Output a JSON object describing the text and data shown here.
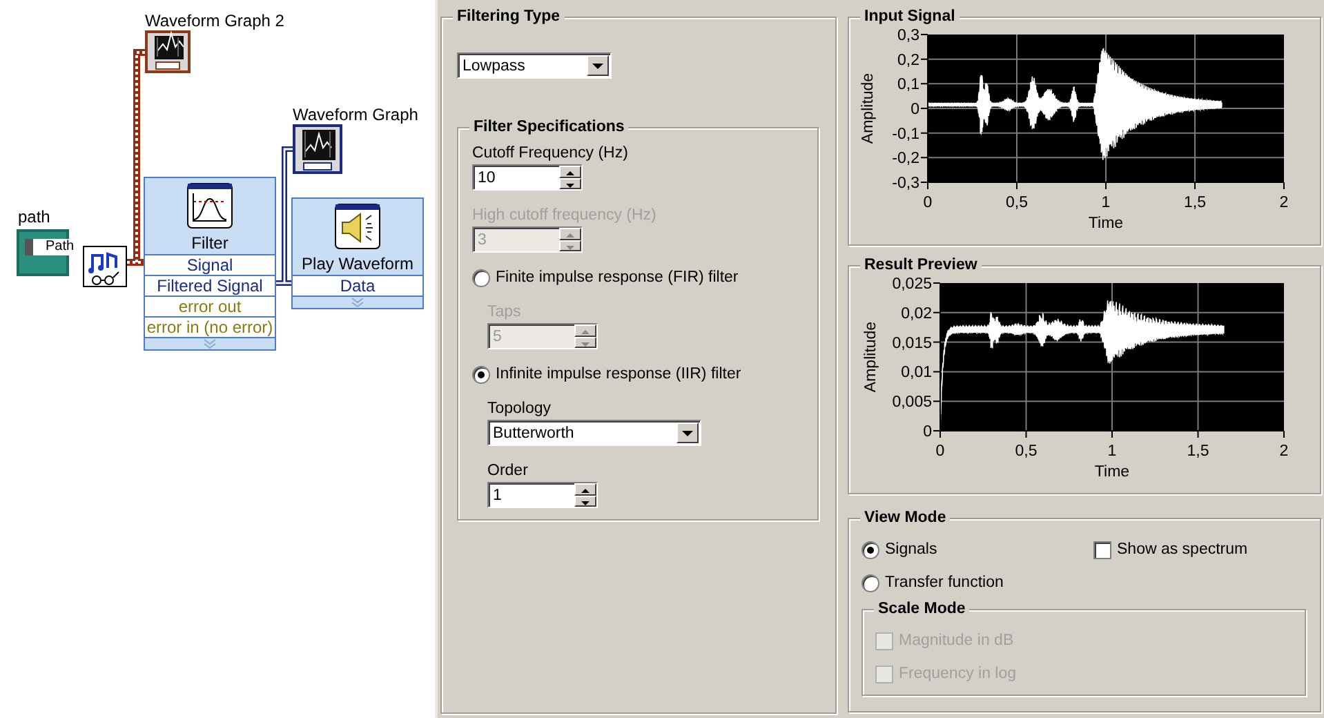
{
  "diagram": {
    "path_control": {
      "label": "path",
      "value": "Path"
    },
    "graph_indicators": [
      {
        "label": "Waveform Graph 2",
        "color": "#8b3a1a"
      },
      {
        "label": "Waveform Graph",
        "color": "#1a2a80"
      }
    ],
    "filter_node": {
      "title": "Filter",
      "terminals": [
        {
          "label": "Signal",
          "kind": "signal"
        },
        {
          "label": "Filtered Signal",
          "kind": "signal"
        },
        {
          "label": "error out",
          "kind": "error"
        },
        {
          "label": "error in (no error)",
          "kind": "error"
        }
      ]
    },
    "play_node": {
      "title": "Play Waveform",
      "terminals": [
        {
          "label": "Data",
          "kind": "signal"
        }
      ]
    }
  },
  "filtering_type": {
    "title": "Filtering Type",
    "value": "Lowpass"
  },
  "filter_specifications": {
    "title": "Filter Specifications",
    "items": [
      {
        "kind": "numeric",
        "label": "Cutoff Frequency (Hz)",
        "value": "10",
        "disabled": false
      },
      {
        "kind": "numeric",
        "label": "High cutoff frequency (Hz)",
        "value": "3",
        "disabled": true
      },
      {
        "kind": "radio",
        "label": "Finite impulse response (FIR) filter",
        "selected": false,
        "children": [
          {
            "kind": "numeric",
            "label": "Taps",
            "value": "5",
            "disabled": true
          }
        ]
      },
      {
        "kind": "radio",
        "label": "Infinite impulse response (IIR) filter",
        "selected": true,
        "children": [
          {
            "kind": "dropdown",
            "label": "Topology",
            "value": "Butterworth"
          },
          {
            "kind": "numeric",
            "label": "Order",
            "value": "1",
            "disabled": false
          }
        ]
      }
    ]
  },
  "graphs": [
    {
      "kind": "input",
      "title": "Input Signal",
      "ylabel": "Amplitude",
      "xlabel": "Time",
      "yticks": [
        "0,3",
        "0,2",
        "0,1",
        "0",
        "-0,1",
        "-0,2",
        "-0,3"
      ],
      "xticks": [
        "0",
        "0,5",
        "1",
        "1,5",
        "2"
      ]
    },
    {
      "kind": "result",
      "title": "Result Preview",
      "ylabel": "Amplitude",
      "xlabel": "Time",
      "yticks": [
        "0,025",
        "0,02",
        "0,015",
        "0,01",
        "0,005",
        "0"
      ],
      "xticks": [
        "0",
        "0,5",
        "1",
        "1,5",
        "2"
      ]
    }
  ],
  "view_mode": {
    "title": "View Mode",
    "options": [
      {
        "label": "Signals",
        "selected": true
      },
      {
        "label": "Transfer function",
        "selected": false
      }
    ],
    "spectrum": {
      "label": "Show as spectrum",
      "checked": false
    },
    "scale_mode": {
      "title": "Scale Mode",
      "options": [
        {
          "label": "Magnitude in dB",
          "checked": false,
          "disabled": true
        },
        {
          "label": "Frequency in log",
          "checked": false,
          "disabled": true
        }
      ]
    }
  }
}
